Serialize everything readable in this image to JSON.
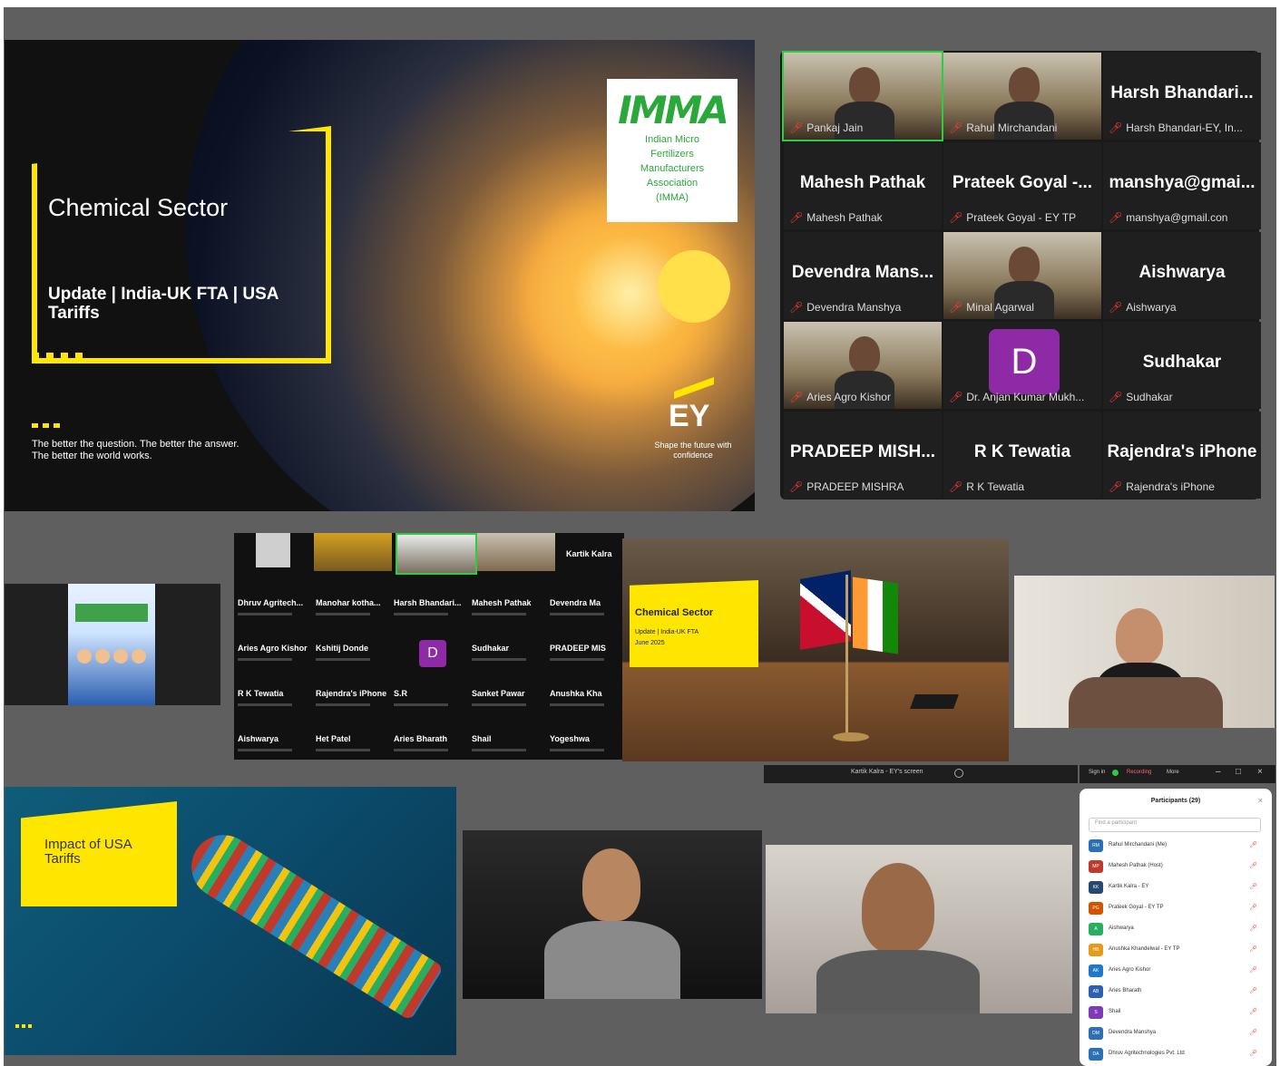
{
  "slide_main": {
    "title": "Chemical Sector",
    "subtitle": "Update | India-UK FTA | USA Tariffs",
    "tagline_1": "The better the question. The better the answer.",
    "tagline_2": "The better the world works.",
    "imma_logo": "IMMA",
    "imma_lines": [
      "Indian Micro",
      "Fertilizers",
      "Manufacturers",
      "Association",
      "(IMMA)"
    ],
    "ey_logo": "EY",
    "ey_tag": "Shape the future with confidence"
  },
  "gallery": {
    "tiles": [
      {
        "name": "",
        "label": "Pankaj Jain",
        "video": true
      },
      {
        "name": "",
        "label": "Rahul Mirchandani",
        "video": true
      },
      {
        "name": "Harsh Bhandari...",
        "label": "Harsh Bhandari-EY, In..."
      },
      {
        "name": "Mahesh Pathak",
        "label": "Mahesh Pathak"
      },
      {
        "name": "Prateek Goyal -...",
        "label": "Prateek Goyal - EY TP"
      },
      {
        "name": "manshya@gmai...",
        "label": "manshya@gmail.con"
      },
      {
        "name": "Devendra Mans...",
        "label": "Devendra Manshya"
      },
      {
        "name": "",
        "label": "Minal Agarwal",
        "video": true
      },
      {
        "name": "Aishwarya",
        "label": "Aishwarya"
      },
      {
        "name": "",
        "label": "Aries Agro Kishor",
        "video": true
      },
      {
        "name": "",
        "label": "Dr. Anjan Kumar Mukh...",
        "avatar": "D"
      },
      {
        "name": "Sudhakar",
        "label": "Sudhakar"
      },
      {
        "name": "PRADEEP MISH...",
        "label": "PRADEEP MISHRA"
      },
      {
        "name": "R K Tewatia",
        "label": "R K Tewatia"
      },
      {
        "name": "Rajendra's iPhone",
        "label": "Rajendra's iPhone"
      }
    ]
  },
  "mini_gallery": {
    "rows": [
      [
        "Dhruv Agritech...",
        "Manohar kotha...",
        "Harsh Bhandari...",
        "Mahesh Pathak",
        "Devendra Ma"
      ],
      [
        "Aries Agro Kishor",
        "Kshitij Donde",
        "D",
        "Sudhakar",
        "PRADEEP MIS"
      ],
      [
        "R K Tewatia",
        "Rajendra's iPhone",
        "S.R",
        "Sanket Pawar",
        "Anushka Kha"
      ],
      [
        "Aishwarya",
        "Het Patel",
        "Aries Bharath",
        "Shail",
        "Yogeshwa"
      ]
    ],
    "top_right_name": "Kartik Kalra"
  },
  "slide_uk": {
    "title": "Chemical Sector",
    "subtitle": "Update | India-UK FTA",
    "date": "June 2025"
  },
  "slide_ship": {
    "title": "Impact of USA Tariffs"
  },
  "toolbar": {
    "center_label": "Kartik Kalra - EY's screen",
    "signin": "Sign in",
    "recording": "Recording",
    "more": "More"
  },
  "participants": {
    "title": "Participants (29)",
    "search_placeholder": "Find a participant",
    "items": [
      {
        "initials": "RM",
        "name": "Rahul Mirchandani (Me)",
        "color": "#2d6fb4"
      },
      {
        "initials": "MP",
        "name": "Mahesh Pathak (Host)",
        "color": "#c0392b"
      },
      {
        "initials": "KK",
        "name": "Kartik Kalra - EY",
        "color": "#27496d"
      },
      {
        "initials": "PG",
        "name": "Prateek Goyal - EY TP",
        "color": "#d35400"
      },
      {
        "initials": "A",
        "name": "Aishwarya",
        "color": "#27ae60"
      },
      {
        "initials": "HB",
        "name": "Anushka Khandelwal - EY TP",
        "color": "#e69a1c"
      },
      {
        "initials": "AK",
        "name": "Aries Agro Kishor",
        "color": "#1f78c8"
      },
      {
        "initials": "AB",
        "name": "Aries Bharath",
        "color": "#2d5fb4"
      },
      {
        "initials": "S",
        "name": "Shail",
        "color": "#7d3cb5"
      },
      {
        "initials": "DM",
        "name": "Devendra Manshya",
        "color": "#2d6fb4"
      },
      {
        "initials": "DA",
        "name": "Dhruv Agritechnologies Pvt. Ltd",
        "color": "#2d6fb4"
      }
    ]
  }
}
